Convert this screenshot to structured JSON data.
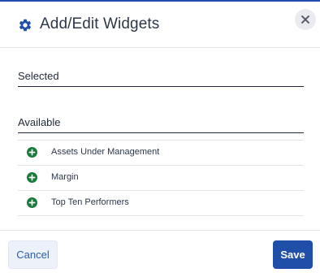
{
  "dialog": {
    "title": "Add/Edit Widgets",
    "title_icon": "gear-icon",
    "close_icon": "close-icon"
  },
  "sections": {
    "selected_label": "Selected",
    "available_label": "Available"
  },
  "available_widgets": [
    {
      "label": "Assets Under Management",
      "icon": "add-circle-icon"
    },
    {
      "label": "Margin",
      "icon": "add-circle-icon"
    },
    {
      "label": "Top Ten Performers",
      "icon": "add-circle-icon"
    }
  ],
  "footer": {
    "cancel_label": "Cancel",
    "save_label": "Save"
  },
  "colors": {
    "brand_blue": "#1f4fa8",
    "add_green": "#1a7a3c",
    "cancel_bg": "#edf2fa"
  }
}
